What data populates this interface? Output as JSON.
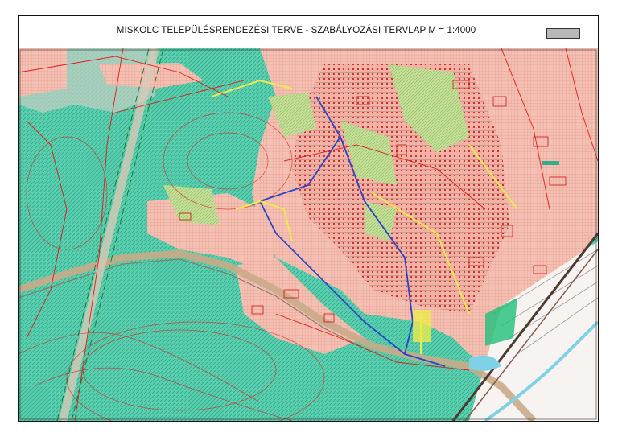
{
  "header": {
    "title": "MISKOLC TELEPÜLÉSRENDEZÉSI TERVE -  SZABÁLYOZÁSI TERVLAP M = 1:4000"
  },
  "legend": {
    "swatch_color": "#b8b8b8"
  },
  "colors": {
    "forest": "#3fc6a0",
    "residential": "#f3b6a8",
    "garden": "#b9d98a",
    "road_axis": "#2a44c8",
    "regulation_line": "#e01b1b",
    "transport_band": "#c9ab88",
    "path_yellow": "#ecea4e",
    "industrial": "#f7f3f0",
    "water": "#7fd2e6"
  }
}
